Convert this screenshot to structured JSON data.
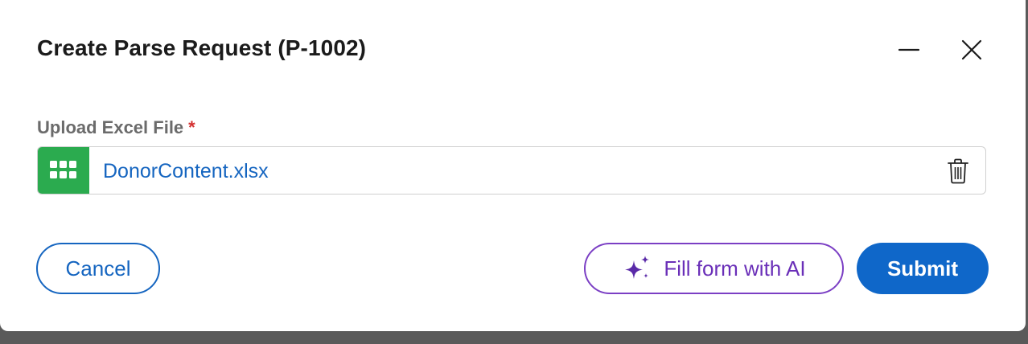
{
  "dialog": {
    "title": "Create Parse Request (P-1002)",
    "minimize_icon": "minimize-icon",
    "close_icon": "close-icon"
  },
  "upload": {
    "label": "Upload Excel File",
    "required_marker": "*",
    "file_type_icon": "excel-grid-icon",
    "file_name": "DonorContent.xlsx",
    "delete_icon": "trash-icon"
  },
  "actions": {
    "cancel_label": "Cancel",
    "ai_label": "Fill form with AI",
    "ai_icon": "sparkle-icon",
    "submit_label": "Submit"
  },
  "colors": {
    "accent": "#1565c0",
    "submit_bg": "#0f67c9",
    "ai_purple": "#7b3fc4",
    "excel_green": "#2bab4f",
    "required_red": "#d32f2f"
  }
}
